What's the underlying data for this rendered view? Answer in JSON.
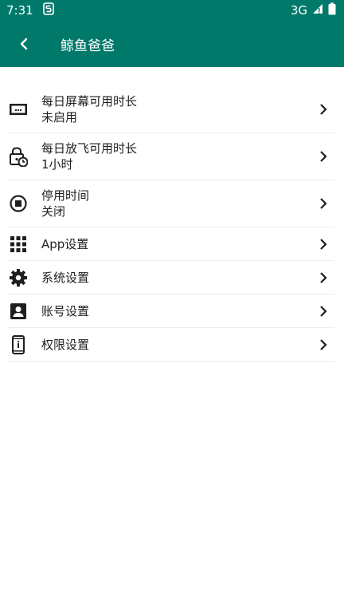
{
  "status": {
    "time": "7:31",
    "network": "3G"
  },
  "app_bar": {
    "title": "鲸鱼爸爸"
  },
  "items": [
    {
      "title": "每日屏幕可用时长",
      "subtitle": "未启用",
      "icon": "screen-time-icon"
    },
    {
      "title": "每日放飞可用时长",
      "subtitle": "1小时",
      "icon": "lock-clock-icon"
    },
    {
      "title": "停用时间",
      "subtitle": "关闭",
      "icon": "stop-circle-icon"
    },
    {
      "title": "App设置",
      "icon": "apps-grid-icon"
    },
    {
      "title": "系统设置",
      "icon": "gear-icon"
    },
    {
      "title": "账号设置",
      "icon": "account-box-icon"
    },
    {
      "title": "权限设置",
      "icon": "phone-info-icon"
    }
  ],
  "colors": {
    "primary": "#00796b",
    "text": "#1f1f1f",
    "divider": "#ececec"
  }
}
